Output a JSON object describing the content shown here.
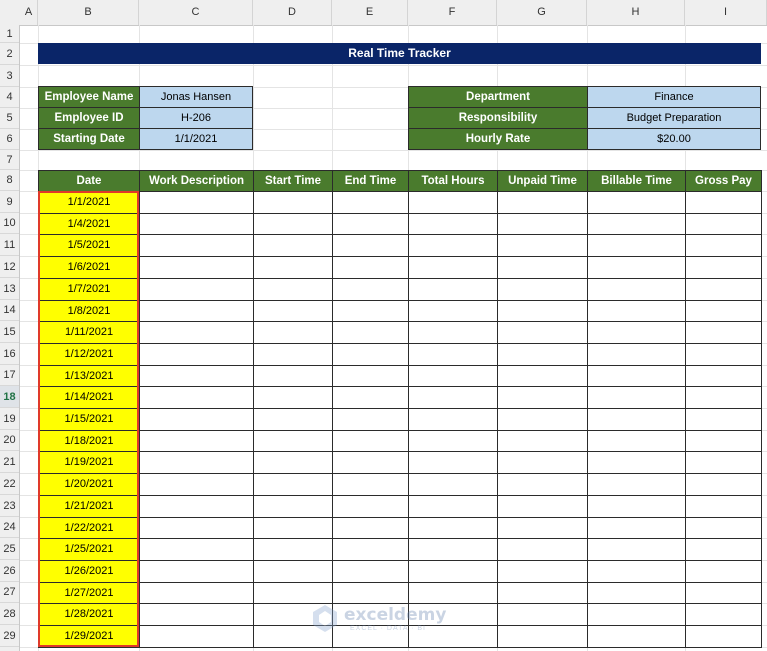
{
  "columns": [
    "A",
    "B",
    "C",
    "D",
    "E",
    "F",
    "G",
    "H",
    "I"
  ],
  "rows": [
    "1",
    "2",
    "3",
    "4",
    "5",
    "6",
    "7",
    "8",
    "9",
    "10",
    "11",
    "12",
    "13",
    "14",
    "15",
    "16",
    "17",
    "18",
    "19",
    "20",
    "21",
    "22",
    "23",
    "24",
    "25",
    "26",
    "27",
    "28",
    "29"
  ],
  "active_row": "18",
  "title": "Real Time Tracker",
  "info_left": [
    {
      "label": "Employee Name",
      "value": "Jonas Hansen"
    },
    {
      "label": "Employee ID",
      "value": "H-206"
    },
    {
      "label": "Starting Date",
      "value": "1/1/2021"
    }
  ],
  "info_right": [
    {
      "label": "Department",
      "value": "Finance"
    },
    {
      "label": "Responsibility",
      "value": "Budget Preparation"
    },
    {
      "label": "Hourly Rate",
      "value": "$20.00"
    }
  ],
  "table_headers": [
    "Date",
    "Work Description",
    "Start Time",
    "End Time",
    "Total Hours",
    "Unpaid Time",
    "Billable Time",
    "Gross Pay"
  ],
  "dates": [
    "1/1/2021",
    "1/4/2021",
    "1/5/2021",
    "1/6/2021",
    "1/7/2021",
    "1/8/2021",
    "1/11/2021",
    "1/12/2021",
    "1/13/2021",
    "1/14/2021",
    "1/15/2021",
    "1/18/2021",
    "1/19/2021",
    "1/20/2021",
    "1/21/2021",
    "1/22/2021",
    "1/25/2021",
    "1/26/2021",
    "1/27/2021",
    "1/28/2021",
    "1/29/2021"
  ],
  "watermark": {
    "brand": "exceldemy",
    "tagline": "EXCEL · DATA · BI"
  },
  "colors": {
    "header_green": "#4a7b2d",
    "title_navy": "#0a2568",
    "value_blue": "#bdd7ee",
    "date_yellow": "#ffff00",
    "highlight_red": "#e03a2a"
  }
}
